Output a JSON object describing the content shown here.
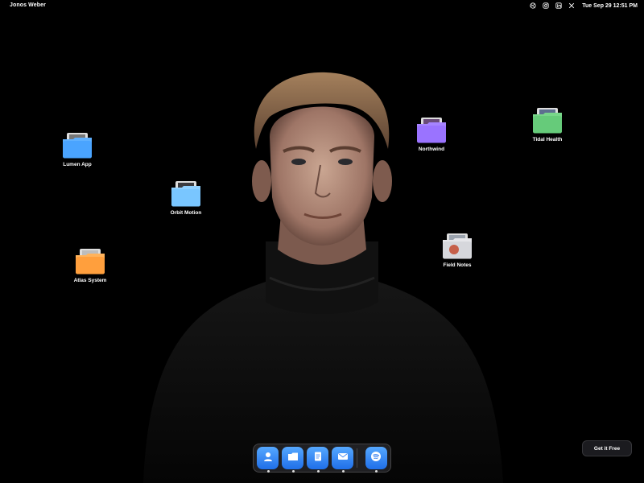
{
  "menubar": {
    "brand": "Jonos Weber",
    "clock": "Tue Sep 29 12:51 PM",
    "icons": [
      "dribbble-icon",
      "instagram-icon",
      "linkedin-icon",
      "x-icon"
    ]
  },
  "desktop": {
    "folders": [
      {
        "label": "Lumen App",
        "color": "#5fb0ff"
      },
      {
        "label": "Orbit Motion",
        "color": "#8fd0ff"
      },
      {
        "label": "Atlas System",
        "color": "#ffb35c"
      },
      {
        "label": "Northwind",
        "color": "#a684ff"
      },
      {
        "label": "Tidal Health",
        "color": "#78d68a"
      },
      {
        "label": "Field Notes",
        "color": "#e6e6ea"
      }
    ]
  },
  "dock": {
    "items": [
      "contacts-icon",
      "files-icon",
      "notes-icon",
      "mail-icon",
      "spotify-icon"
    ]
  },
  "cta": {
    "label": "Get it Free"
  }
}
